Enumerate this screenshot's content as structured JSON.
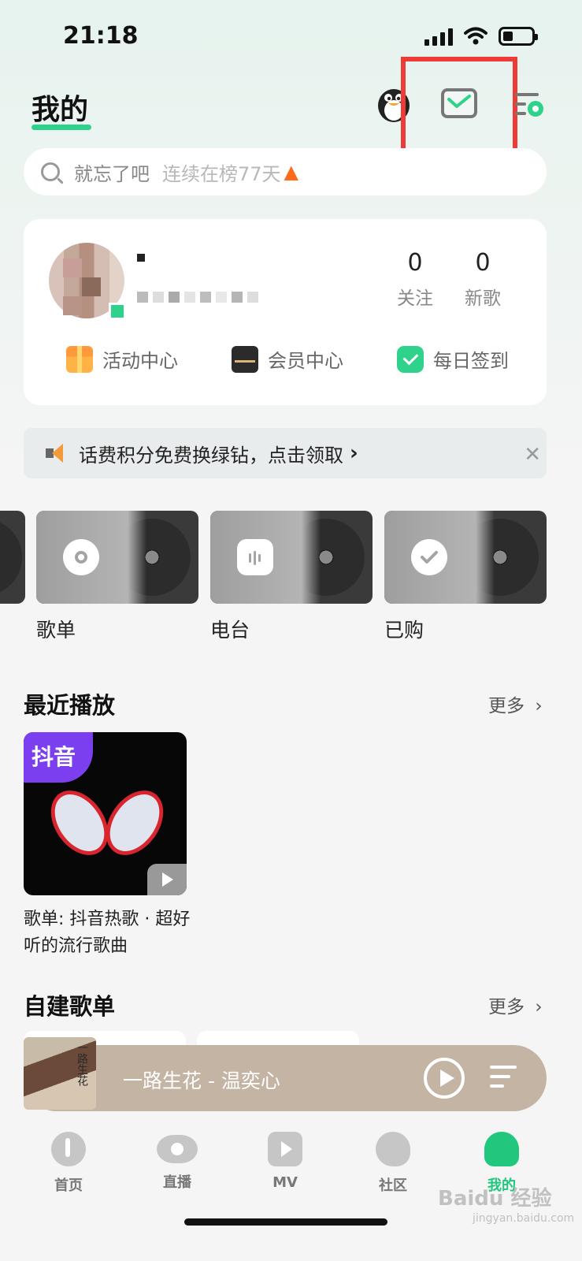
{
  "status": {
    "time": "21:18"
  },
  "header": {
    "title": "我的"
  },
  "search": {
    "query": "就忘了吧",
    "hint": "连续在榜77天"
  },
  "profile": {
    "following_count": "0",
    "following_label": "关注",
    "new_songs_count": "0",
    "new_songs_label": "新歌",
    "links": [
      "活动中心",
      "会员中心",
      "每日签到"
    ]
  },
  "banner": {
    "text": "话费积分免费换绿钻，点击领取"
  },
  "tiles": [
    "歌单",
    "电台",
    "已购"
  ],
  "recent": {
    "title": "最近播放",
    "more": "更多",
    "item": {
      "badge": "抖音",
      "title": "歌单: 抖音热歌 · 超好听的流行歌曲"
    }
  },
  "custom_playlists": {
    "title": "自建歌单",
    "more": "更多"
  },
  "player": {
    "track": "一路生花 - 温奕心",
    "cover_text": "一路生花"
  },
  "tabbar": [
    "首页",
    "直播",
    "MV",
    "社区",
    "我的"
  ],
  "watermark": {
    "main": "Baidu 经验",
    "sub": "jingyan.baidu.com"
  },
  "colors": {
    "accent": "#2fd28a",
    "highlight": "#ee3b36",
    "player": "#c4b4a4"
  }
}
